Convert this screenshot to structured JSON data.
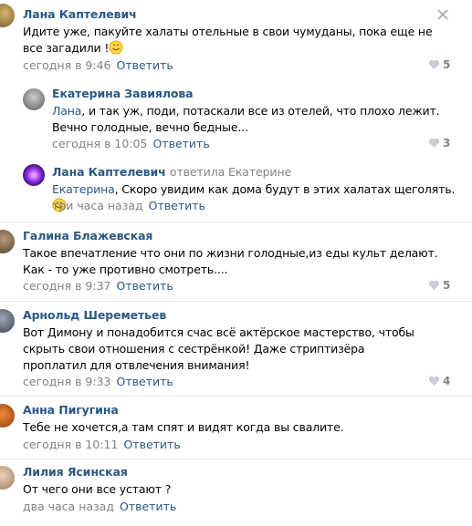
{
  "close_icon": "close-icon",
  "colors": {
    "link": "#2a5885",
    "meta": "#828282",
    "text": "#000000",
    "separator": "#e7e8ec"
  },
  "comments": [
    {
      "author": "Лана Каптелевич",
      "text_before": "Идите уже, пакуйте халаты отельные в свои чумуданы, пока еще не все загадили !",
      "emoji": "smile-emoji",
      "date": "сегодня в 9:46",
      "reply": "Ответить",
      "likes": "5"
    },
    {
      "author": "Екатерина Завиялова",
      "mention": "Лана",
      "text": ", и так уж, поди, потаскали все из отелей, что плохо лежит. Вечно голодные, вечно бедные...",
      "date": "сегодня в 10:05",
      "reply": "Ответить",
      "likes": "3"
    },
    {
      "author": "Лана Каптелевич",
      "replied_to": "ответила Екатерине",
      "mention": "Екатерина",
      "text": ", Скоро увидим как дома будут в этих халатах щеголять.",
      "emoji": "smile-emoji",
      "date": "три часа назад",
      "reply": "Ответить"
    },
    {
      "author": "Галина Блажевская",
      "text": "Такое впечатление что они по жизни голодные,из еды культ делают. Как - то уже противно смотреть....",
      "date": "сегодня в 9:37",
      "reply": "Ответить",
      "likes": "5"
    },
    {
      "author": "Арнольд Шереметьев",
      "text": "Вот Димону и понадобится счас всё актёрское мастерство, чтобы скрыть свои отношения с сестрёнкой! Даже стриптизёра проплатил для отвлечения внимания!",
      "date": "сегодня в 9:33",
      "reply": "Ответить",
      "likes": "4"
    },
    {
      "author": "Анна Пигугина",
      "text": "Тебе не хочется,а там спят и видят когда вы свалите.",
      "date": "сегодня в 10:11",
      "reply": "Ответить"
    },
    {
      "author": "Лилия Ясинская",
      "text": "От чего они все устают ?",
      "date": "два часа назад",
      "reply": "Ответить"
    }
  ]
}
